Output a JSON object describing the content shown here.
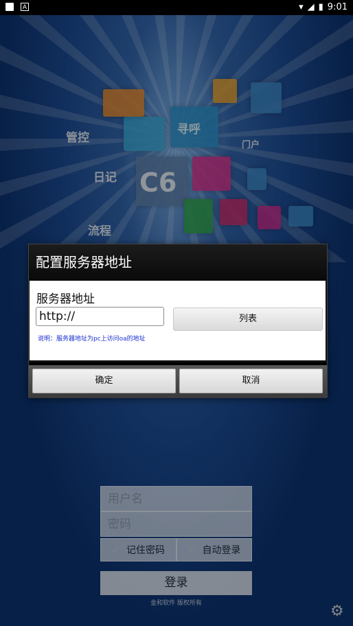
{
  "statusbar": {
    "time": "9:01",
    "notif_icon": "A"
  },
  "splash": {
    "logo": "C6",
    "tiles": [
      "管控",
      "寻呼",
      "日记",
      "门户",
      "流程"
    ]
  },
  "login": {
    "username_placeholder": "用户名",
    "password_placeholder": "密码",
    "remember_label": "记住密码",
    "autologin_label": "自动登录",
    "login_button": "登录",
    "copyright": "金和软件 版权所有"
  },
  "dialog": {
    "title": "配置服务器地址",
    "field_label": "服务器地址",
    "url_value": "http://",
    "list_button": "列表",
    "hint": "说明：服务器地址为pc上访问oa的地址",
    "ok_button": "确定",
    "cancel_button": "取消"
  },
  "colors": {
    "hint": "#1a2fd0",
    "dialog_title_bg": "#111111"
  }
}
